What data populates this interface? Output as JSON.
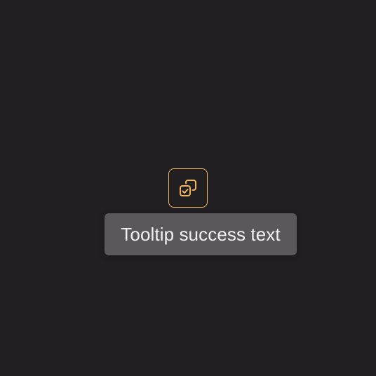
{
  "colors": {
    "background": "#221f23",
    "accent": "#efb55f",
    "tooltip_background": "#5b585b",
    "tooltip_text": "#f3f1f3"
  },
  "copy_button": {
    "icon": "copy-success-icon",
    "aria_label": "Copy"
  },
  "tooltip": {
    "text": "Tooltip success text"
  }
}
